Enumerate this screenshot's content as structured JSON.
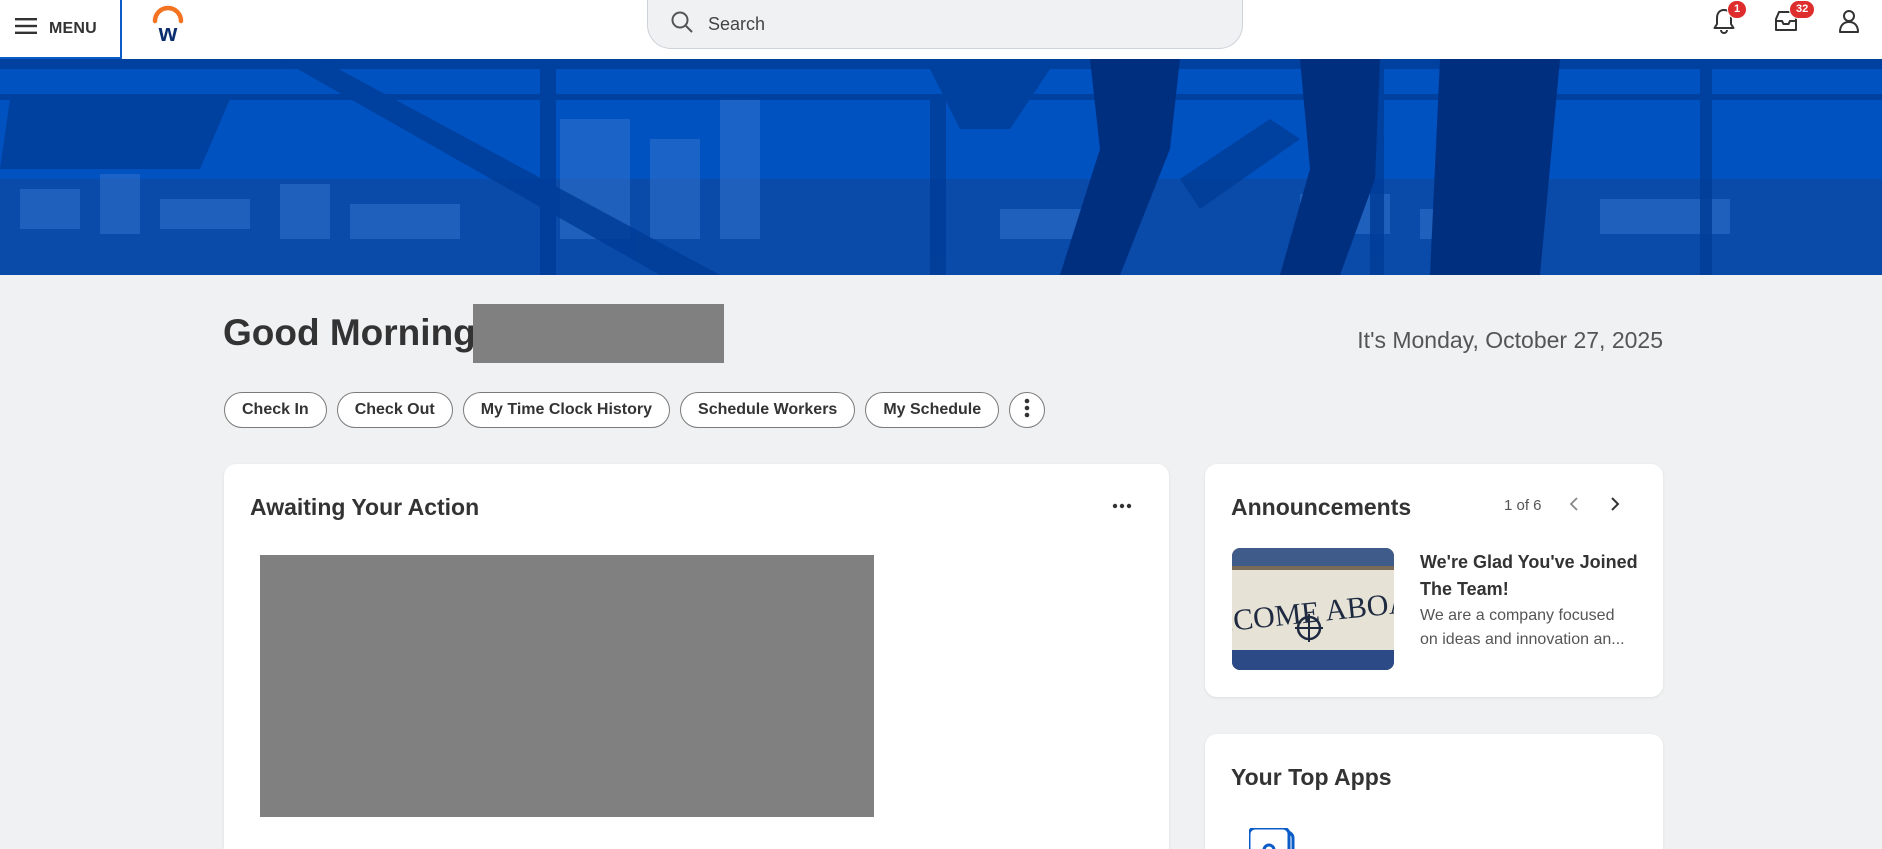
{
  "topbar": {
    "menu_label": "MENU",
    "search_placeholder": "Search",
    "notifications_count": "1",
    "inbox_count": "32"
  },
  "greeting": {
    "text": "Good Morning,",
    "date": "It's Monday, October 27, 2025"
  },
  "quick_actions": [
    "Check In",
    "Check Out",
    "My Time Clock History",
    "Schedule Workers",
    "My Schedule"
  ],
  "awaiting": {
    "title": "Awaiting Your Action"
  },
  "announcements": {
    "title": "Announcements",
    "pager": "1 of 6",
    "item_title": "We're Glad You've Joined The Team!",
    "item_body": "We are a company focused on ideas and innovation an...",
    "image_text": "ELCOME ABOAR"
  },
  "top_apps": {
    "title": "Your Top Apps"
  },
  "colors": {
    "brand_blue": "#0055c4",
    "badge_red": "#de2d2d",
    "logo_orange": "#f37321",
    "logo_navy": "#0b2e6e"
  }
}
